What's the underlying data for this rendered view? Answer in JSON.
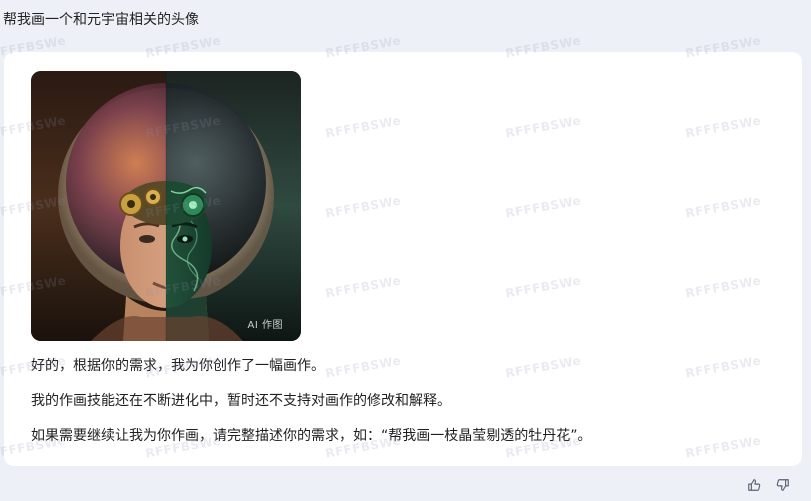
{
  "user_prompt": "帮我画一个和元宇宙相关的头像",
  "reply": {
    "image_badge": "AI 作图",
    "paragraphs": [
      "好的，根据你的需求，我为你创作了一幅画作。",
      "我的作画技能还在不断进化中，暂时还不支持对画作的修改和解释。",
      "如果需要继续让我为你作画，请完整描述你的需求，如：“帮我画一枝晶莹剔透的牡丹花”。"
    ]
  },
  "watermark_text": "RFFFBSWe",
  "feedback": {
    "like_icon": "thumbs-up-icon",
    "dislike_icon": "thumbs-down-icon"
  }
}
